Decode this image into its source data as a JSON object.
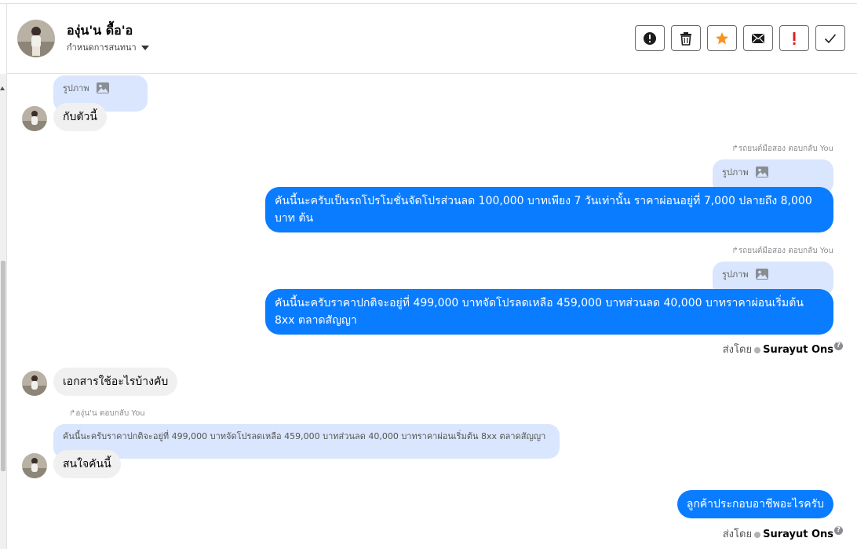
{
  "header": {
    "contact_name": "องุ่น'น ดื้อ'อ",
    "conversation_setting": "กำหนดการสนทนา"
  },
  "actions": [
    {
      "name": "report-button",
      "icon": "alert-circle-icon"
    },
    {
      "name": "delete-button",
      "icon": "trash-icon"
    },
    {
      "name": "star-button",
      "icon": "star-icon",
      "color": "#f7931e"
    },
    {
      "name": "email-button",
      "icon": "envelope-icon"
    },
    {
      "name": "important-button",
      "icon": "exclamation-icon",
      "color": "#e02020"
    },
    {
      "name": "done-button",
      "icon": "check-icon"
    }
  ],
  "messages": {
    "m1_image": "รูปภาพ",
    "m1_text": "กับตัวนี้",
    "m2_reply": "รถยนต์มือสอง ตอบกลับ You",
    "m2_image": "รูปภาพ",
    "m2_text": "คันนี้นะครับเป็นรถโปรโมชั่นจัดโปรส่วนลด 100,000 บาทเพียง 7 วันเท่านั้น ราคาผ่อนอยู่ที่ 7,000 ปลายถึง 8,000 บาท ต้น",
    "m3_reply": "รถยนต์มือสอง ตอบกลับ You",
    "m3_image": "รูปภาพ",
    "m3_text": "คันนี้นะครับราคาปกติจะอยู่ที่ 499,000 บาทจัดโปรลดเหลือ 459,000 บาทส่วนลด 40,000 บาทราคาผ่อนเริ่มต้น 8xx ตลาดสัญญา",
    "m3_sent_prefix": "ส่งโดย",
    "m3_sent_by": "Surayut Ons",
    "m4_text": "เอกสารใช้อะไรบ้างคับ",
    "m5_reply": "องุ่น'น ตอบกลับ You",
    "m5_quote": "คันนี้นะครับราคาปกติจะอยู่ที่ 499,000 บาทจัดโปรลดเหลือ 459,000 บาทส่วนลด 40,000 บาทราคาผ่อนเริ่มต้น 8xx ตลาดสัญญา",
    "m5_text": "สนใจคันนี้",
    "m6_text": "ลูกค้าประกอบอาชีพอะไรครับ",
    "m6_sent_prefix": "ส่งโดย",
    "m6_sent_by": "Surayut Ons"
  },
  "colors": {
    "outgoing_bubble": "#0a7cff",
    "incoming_bubble": "#f0f0f0",
    "image_bubble": "#d9e6fd"
  }
}
